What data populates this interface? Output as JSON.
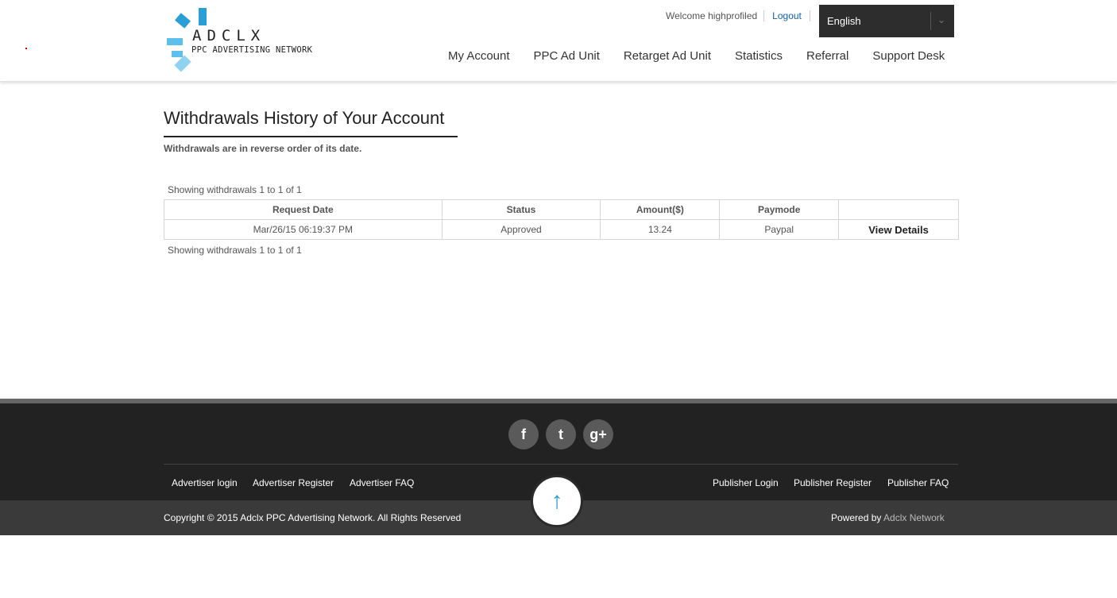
{
  "header": {
    "logo_title": "ADCLX",
    "logo_subtitle": "PPC ADVERTISING NETWORK",
    "welcome": "Welcome highprofiled",
    "logout": "Logout",
    "language": "English"
  },
  "nav": {
    "items": [
      "My Account",
      "PPC Ad Unit",
      "Retarget Ad Unit",
      "Statistics",
      "Referral",
      "Support Desk"
    ]
  },
  "main": {
    "title": "Withdrawals History of Your Account",
    "subtitle": "Withdrawals are in reverse order of its date.",
    "count_top": "Showing withdrawals 1 to 1 of 1",
    "count_bottom": "Showing withdrawals 1 to 1 of 1",
    "table": {
      "headers": [
        "Request Date",
        "Status",
        "Amount($)",
        "Paymode",
        ""
      ],
      "rows": [
        {
          "date": "Mar/26/15 06:19:37 PM",
          "status": "Approved",
          "amount": "13.24",
          "paymode": "Paypal",
          "action": "View Details"
        }
      ]
    }
  },
  "footer": {
    "social": {
      "facebook": "f",
      "twitter": "t",
      "googleplus": "g+"
    },
    "links_left": [
      "Advertiser login",
      "Advertiser Register",
      "Advertiser FAQ"
    ],
    "links_right": [
      "Publisher Login",
      "Publisher Register",
      "Publisher FAQ"
    ],
    "copyright": "Copyright © 2015 Adclx PPC Advertising Network. All Rights Reserved",
    "powered_prefix": "Powered by",
    "powered_brand": "Adclx Network",
    "scroll_top_icon": "↑"
  },
  "colors": {
    "accent": "#2a9fd6",
    "footer_bg": "#222222",
    "copyright_bg": "#3a3a3a",
    "lang_bg": "#2d2d2d"
  }
}
